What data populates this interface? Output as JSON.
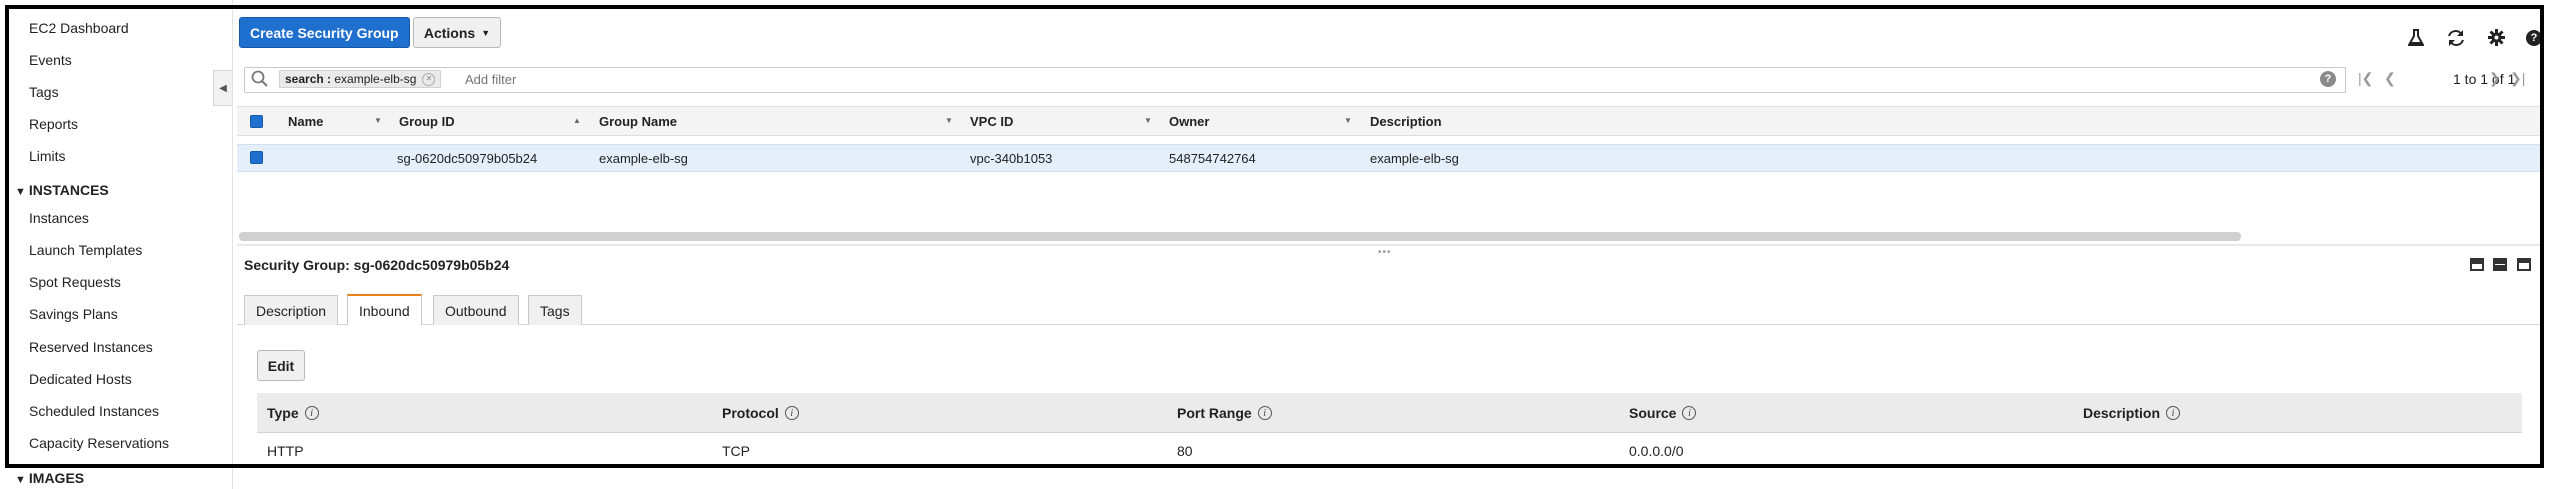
{
  "sidebar": {
    "items": [
      {
        "label": "EC2 Dashboard"
      },
      {
        "label": "Events"
      },
      {
        "label": "Tags"
      },
      {
        "label": "Reports"
      },
      {
        "label": "Limits"
      }
    ],
    "instances_section": "INSTANCES",
    "instances_items": [
      {
        "label": "Instances"
      },
      {
        "label": "Launch Templates"
      },
      {
        "label": "Spot Requests"
      },
      {
        "label": "Savings Plans"
      },
      {
        "label": "Reserved Instances"
      },
      {
        "label": "Dedicated Hosts"
      },
      {
        "label": "Scheduled Instances"
      },
      {
        "label": "Capacity Reservations"
      }
    ],
    "images_section": "IMAGES"
  },
  "toolbar": {
    "create_label": "Create Security Group",
    "actions_label": "Actions"
  },
  "filter": {
    "chip_key": "search :",
    "chip_value": "example-elb-sg",
    "placeholder": "Add filter"
  },
  "pagination": {
    "text": "1 to 1 of 1"
  },
  "table": {
    "columns": [
      "Name",
      "Group ID",
      "Group Name",
      "VPC ID",
      "Owner",
      "Description"
    ],
    "rows": [
      {
        "name": "",
        "group_id": "sg-0620dc50979b05b24",
        "group_name": "example-elb-sg",
        "vpc_id": "vpc-340b1053",
        "owner": "548754742764",
        "description": "example-elb-sg"
      }
    ]
  },
  "details": {
    "title": "Security Group: sg-0620dc50979b05b24",
    "tabs": [
      "Description",
      "Inbound",
      "Outbound",
      "Tags"
    ],
    "active_tab": "Inbound",
    "edit_label": "Edit",
    "rules_columns": [
      "Type",
      "Protocol",
      "Port Range",
      "Source",
      "Description"
    ],
    "rules": [
      {
        "type": "HTTP",
        "protocol": "TCP",
        "port_range": "80",
        "source": "0.0.0.0/0",
        "description": ""
      }
    ]
  },
  "colors": {
    "primary": "#1f6fcf",
    "active_tab_accent": "#e8811c",
    "selected_row": "#e4effa"
  }
}
